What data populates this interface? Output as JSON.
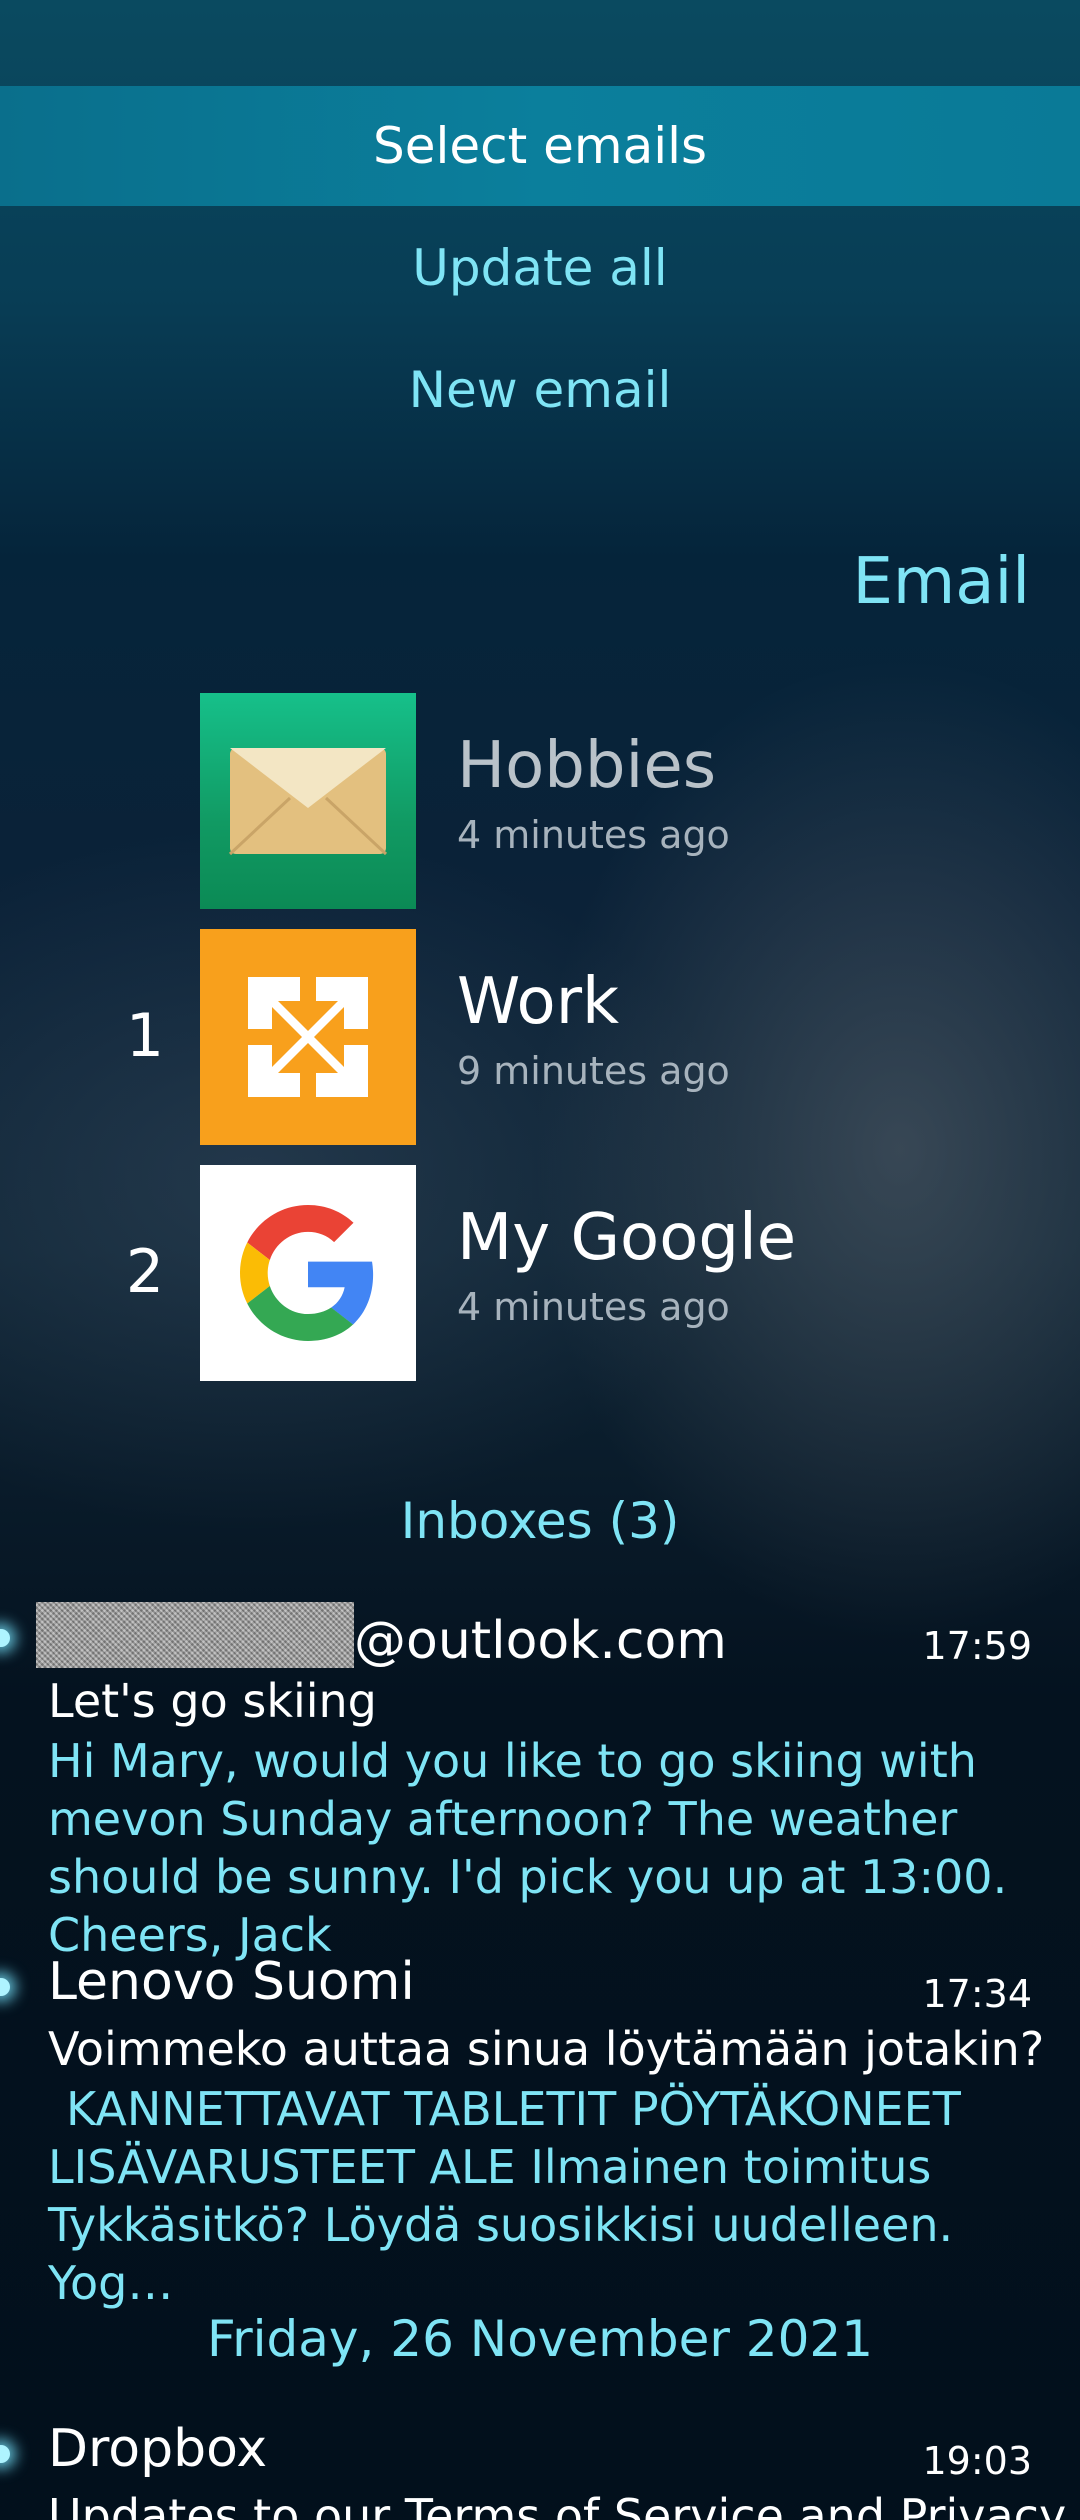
{
  "pulley_menu": {
    "items": [
      {
        "label": "Select emails"
      },
      {
        "label": "Update all"
      },
      {
        "label": "New email"
      }
    ]
  },
  "page": {
    "title": "Email"
  },
  "accounts": [
    {
      "name": "Hobbies",
      "updated": "4 minutes ago",
      "unread": "",
      "icon": "envelope-icon"
    },
    {
      "name": "Work",
      "updated": "9 minutes ago",
      "unread": "1",
      "icon": "exchange-icon"
    },
    {
      "name": "My Google",
      "updated": "4 minutes ago",
      "unread": "2",
      "icon": "google-icon"
    }
  ],
  "inboxes_header": "Inboxes (3)",
  "messages": [
    {
      "sender_suffix": "@outlook.com",
      "time": "17:59",
      "subject": "Let's go skiing",
      "preview": "Hi Mary, would you like to go skiing with mevon Sunday afternoon? The weather should be sunny. I'd pick you up at 13:00. Cheers, Jack"
    },
    {
      "sender": "Lenovo Suomi",
      "time": "17:34",
      "subject": "Voimmeko auttaa sinua löytämään jotakin?",
      "preview": "KANNETTAVAT TABLETIT PÖYTÄKONEET LISÄVARUSTEET ALE  Ilmainen toimitus Tykkäsitkö? Löydä suosikkisi uudelleen.   Yog…"
    }
  ],
  "date_header": "Friday, 26 November 2021",
  "older_messages": [
    {
      "sender": "Dropbox",
      "time": "19:03",
      "subject": "Updates to our Terms of Service and Privacy Pol"
    }
  ],
  "colors": {
    "accent": "#7fe4f5",
    "highlight": "#0a7a97",
    "exchange_orange": "#f8a01c",
    "hobbies_green": "#13a86e"
  }
}
